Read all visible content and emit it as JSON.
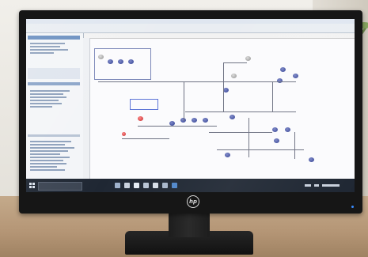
{
  "scene": {
    "monitor_brand_logo": "hp",
    "colors": {
      "bezel": "#161616",
      "taskbar": "#1f2733",
      "diagram_node_blue": "#2c3b8f",
      "diagram_node_red": "#c2282a",
      "sidebar_header": "#6a8fc0",
      "desk": "#b49575"
    },
    "icons": [
      "windows-start-icon",
      "search-icon",
      "taskbar-app-icon",
      "diagram-node-icon",
      "hp-logo-icon"
    ]
  }
}
